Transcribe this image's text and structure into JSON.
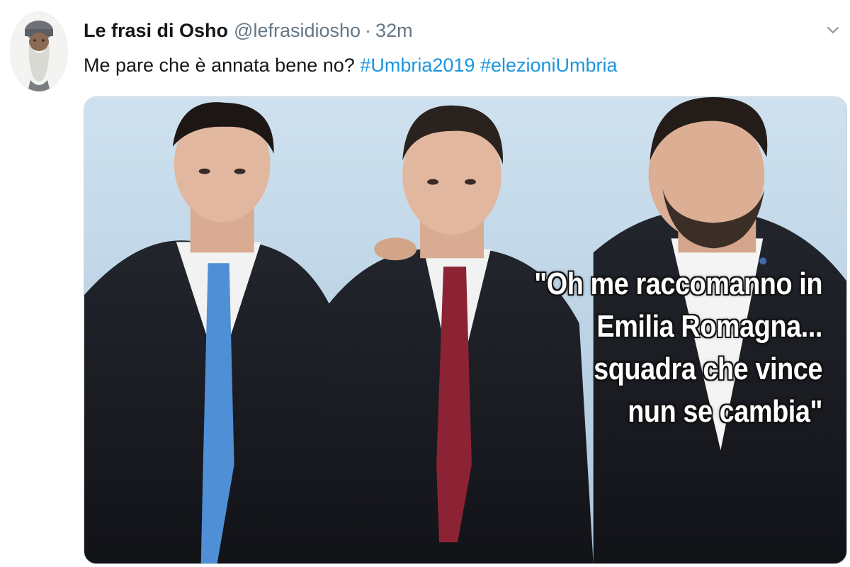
{
  "tweet": {
    "display_name": "Le frasi di Osho",
    "handle": "@lefrasidiosho",
    "separator": "·",
    "timestamp": "32m",
    "text": "Me pare che è annata bene no?",
    "hashtags": [
      "#Umbria2019",
      "#elezioniUmbria"
    ],
    "avatar_icon": "bearded-man-avatar",
    "menu_icon": "chevron-down-icon"
  },
  "media": {
    "caption_lines": [
      "\"Oh me raccomanno in",
      "Emilia Romagna...",
      "squadra che vince",
      "nun se cambia\""
    ]
  },
  "colors": {
    "text": "#14171a",
    "secondary": "#657786",
    "link": "#1b95e0",
    "background_sky": "#c7dcec"
  }
}
